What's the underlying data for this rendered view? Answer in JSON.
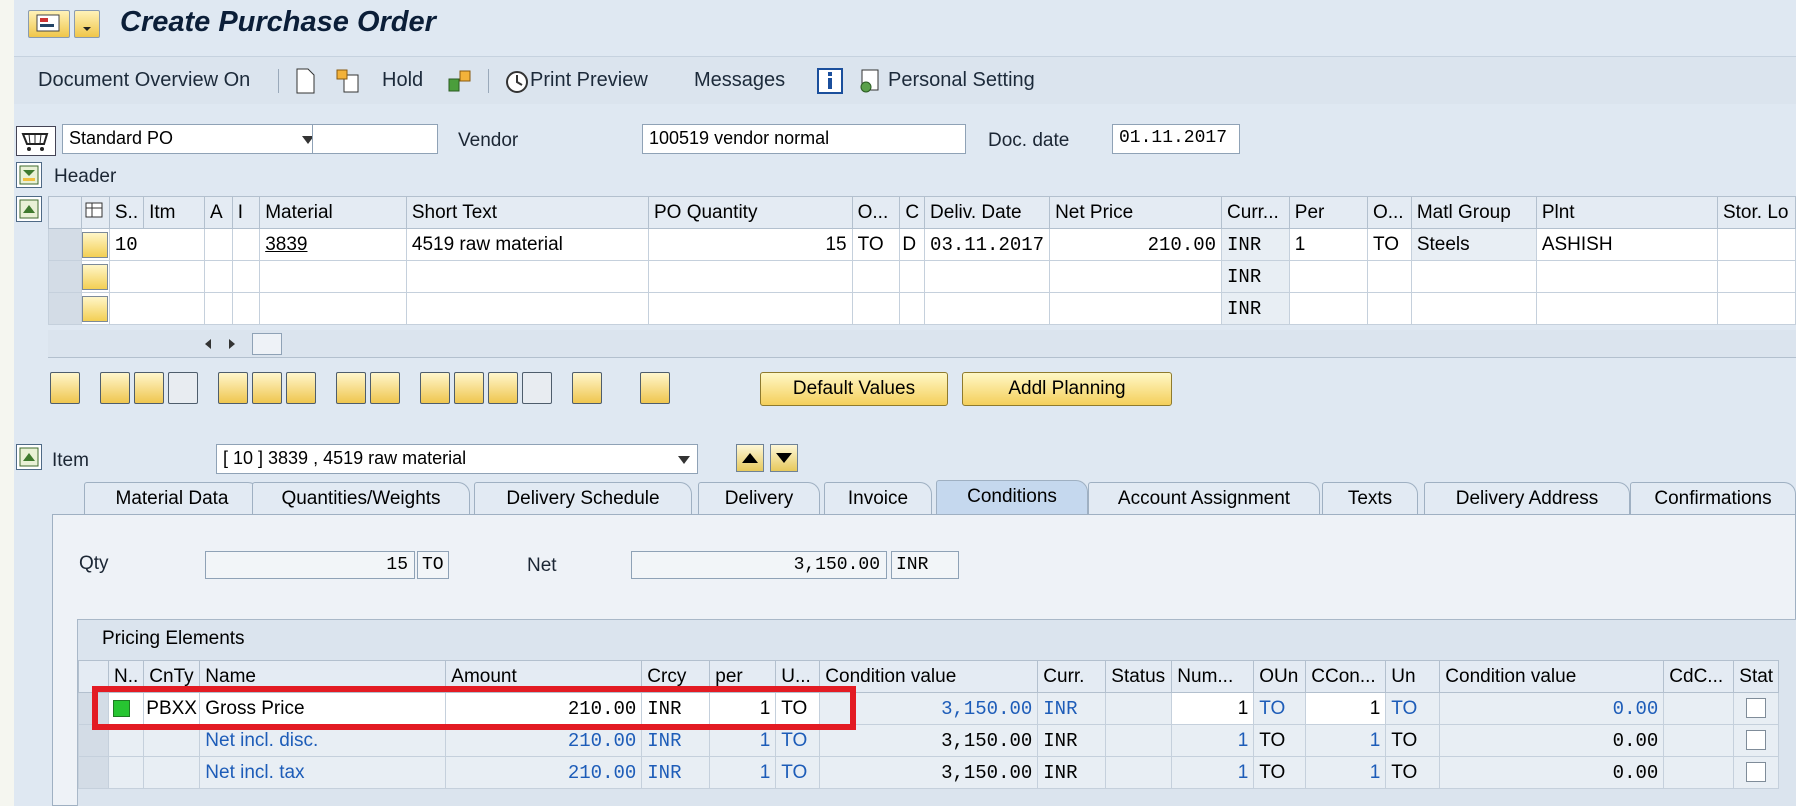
{
  "window": {
    "title": "Create Purchase Order"
  },
  "toolbar": {
    "document_overview": "Document Overview On",
    "hold": "Hold",
    "print_preview": "Print Preview",
    "messages": "Messages",
    "personal_setting": "Personal Setting"
  },
  "po_header": {
    "order_type": "Standard PO",
    "order_number": "",
    "vendor_label": "Vendor",
    "vendor_value": "100519 vendor normal",
    "doc_date_label": "Doc. date",
    "doc_date_value": "01.11.2017",
    "header_label": "Header"
  },
  "item_overview": {
    "columns": [
      "S..",
      "Itm",
      "A",
      "I",
      "Material",
      "Short Text",
      "PO Quantity",
      "O...",
      "C",
      "Deliv. Date",
      "Net Price",
      "Curr...",
      "Per",
      "O...",
      "Matl Group",
      "Plnt",
      "Stor. Lo"
    ],
    "rows": [
      {
        "itm": "10",
        "a": "",
        "i": "",
        "material": "3839",
        "short_text": "4519 raw material",
        "po_qty": "15",
        "oun": "TO",
        "c": "D",
        "deliv_date": "03.11.2017",
        "net_price": "210.00",
        "curr": "INR",
        "per": "1",
        "opu": "TO",
        "matl_group": "Steels",
        "plant": "ASHISH",
        "stor": ""
      },
      {
        "itm": "",
        "a": "",
        "i": "",
        "material": "",
        "short_text": "",
        "po_qty": "",
        "oun": "",
        "c": "",
        "deliv_date": "",
        "net_price": "",
        "curr": "INR",
        "per": "",
        "opu": "",
        "matl_group": "",
        "plant": "",
        "stor": ""
      },
      {
        "itm": "",
        "a": "",
        "i": "",
        "material": "",
        "short_text": "",
        "po_qty": "",
        "oun": "",
        "c": "",
        "deliv_date": "",
        "net_price": "",
        "curr": "INR",
        "per": "",
        "opu": "",
        "matl_group": "",
        "plant": "",
        "stor": ""
      }
    ]
  },
  "buttons": {
    "default_values": "Default Values",
    "addl_planning": "Addl Planning"
  },
  "item_detail": {
    "label": "Item",
    "selected_item": "[ 10 ] 3839 , 4519 raw material",
    "tabs": [
      "Material Data",
      "Quantities/Weights",
      "Delivery Schedule",
      "Delivery",
      "Invoice",
      "Conditions",
      "Account Assignment",
      "Texts",
      "Delivery Address",
      "Confirmations"
    ],
    "active_tab": "Conditions"
  },
  "conditions": {
    "qty_label": "Qty",
    "qty_value": "15",
    "qty_unit": "TO",
    "net_label": "Net",
    "net_value": "3,150.00",
    "net_currency": "INR",
    "pricing_title": "Pricing Elements",
    "columns": [
      "N..",
      "CnTy",
      "Name",
      "Amount",
      "Crcy",
      "per",
      "U...",
      "Condition value",
      "Curr.",
      "Status",
      "Num...",
      "OUn",
      "CCon...",
      "Un",
      "Condition value",
      "CdC...",
      "Stat"
    ],
    "rows": [
      {
        "cnty": "PBXX",
        "name": "Gross Price",
        "amount": "210.00",
        "crcy": "INR",
        "per": "1",
        "uom": "TO",
        "cond_value": "3,150.00",
        "curr": "INR",
        "status": "",
        "num": "1",
        "oun": "TO",
        "ccon": "1",
        "un": "TO",
        "cond_value2": "0.00",
        "cdc": ""
      },
      {
        "cnty": "",
        "name": "Net incl. disc.",
        "amount": "210.00",
        "crcy": "INR",
        "per": "1",
        "uom": "TO",
        "cond_value": "3,150.00",
        "curr": "INR",
        "status": "",
        "num": "1",
        "oun": "TO",
        "ccon": "1",
        "un": "TO",
        "cond_value2": "0.00",
        "cdc": ""
      },
      {
        "cnty": "",
        "name": "Net incl. tax",
        "amount": "210.00",
        "crcy": "INR",
        "per": "1",
        "uom": "TO",
        "cond_value": "3,150.00",
        "curr": "INR",
        "status": "",
        "num": "1",
        "oun": "TO",
        "ccon": "1",
        "un": "TO",
        "cond_value2": "0.00",
        "cdc": ""
      }
    ]
  },
  "colors": {
    "highlight": "#e31b23",
    "link_blue": "#1d5cb8",
    "background": "#dfe8f2"
  }
}
